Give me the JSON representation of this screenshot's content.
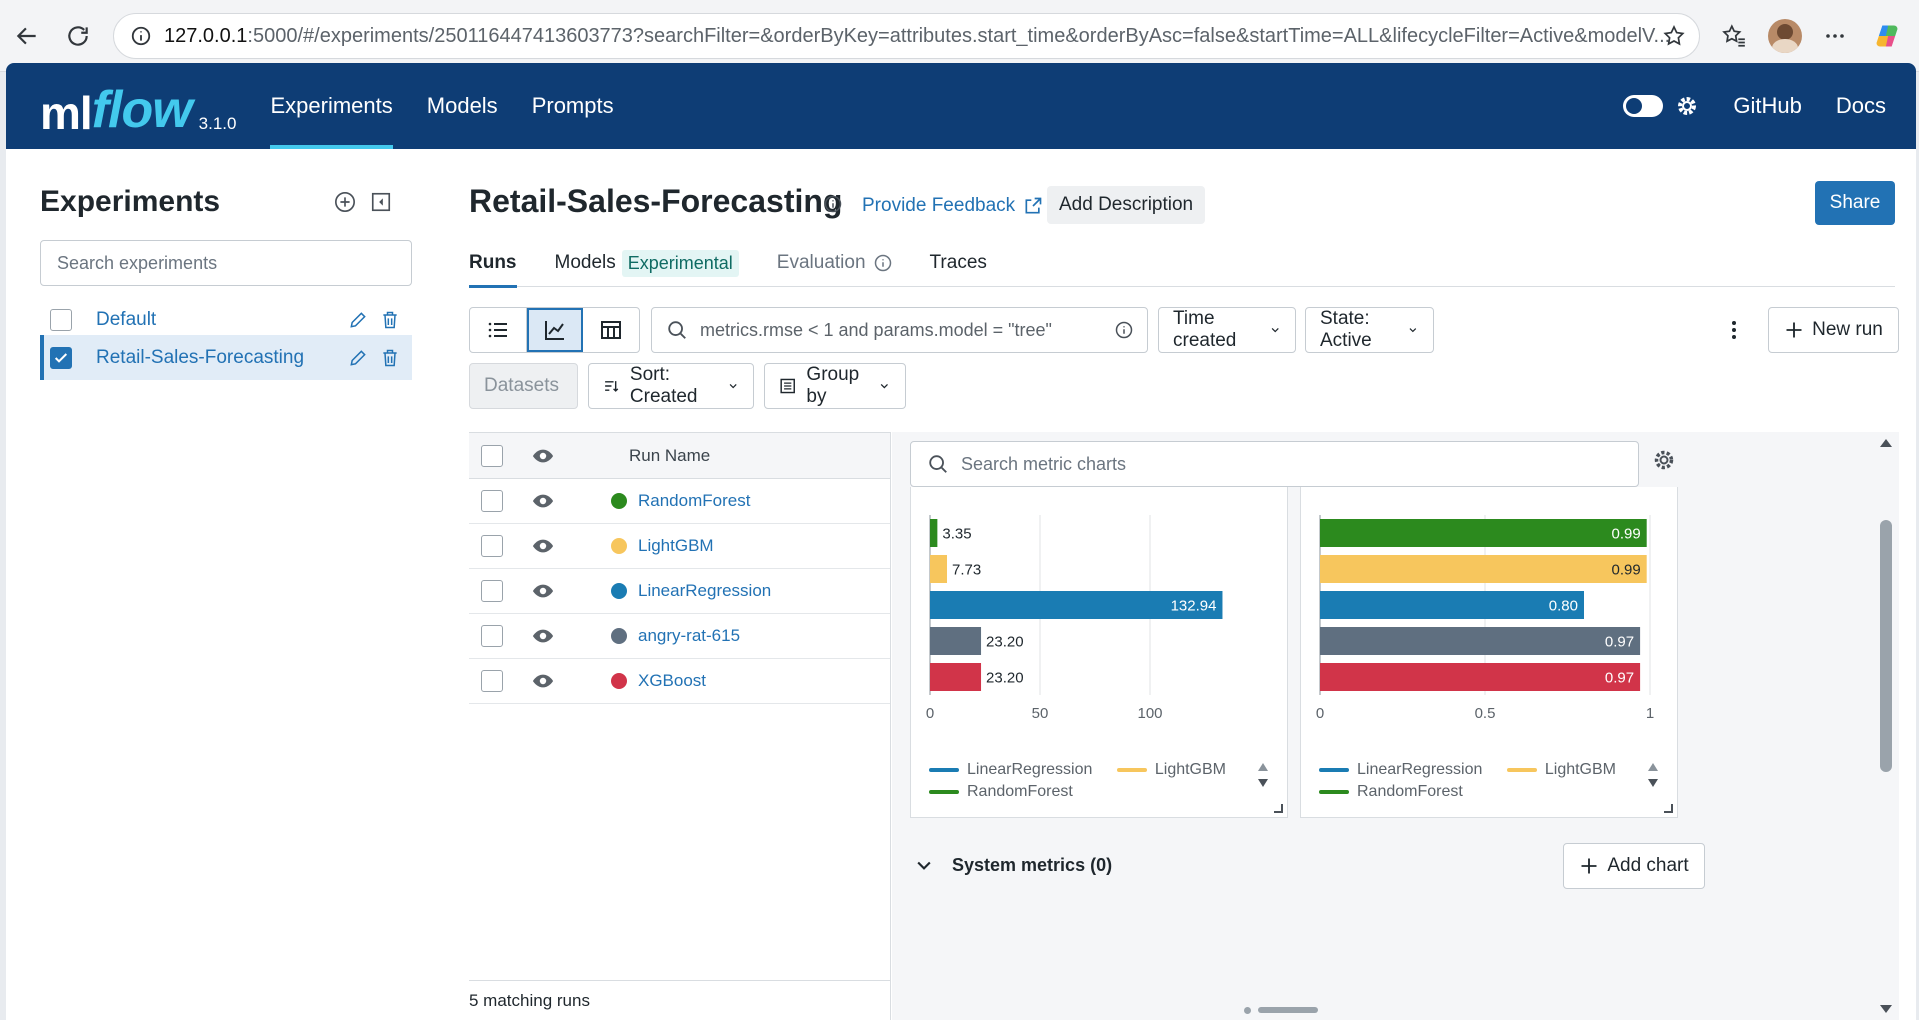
{
  "browser": {
    "url_host": "127.0.0.1",
    "url_rest": ":5000/#/experiments/250116447413603773?searchFilter=&orderByKey=attributes.start_time&orderByAsc=false&startTime=ALL&lifecycleFilter=Active&modelV..."
  },
  "nav": {
    "logo_ml": "ml",
    "logo_flow": "flow",
    "version": "3.1.0",
    "links": [
      "Experiments",
      "Models",
      "Prompts"
    ],
    "github": "GitHub",
    "docs": "Docs"
  },
  "sidebar": {
    "title": "Experiments",
    "search_placeholder": "Search experiments",
    "experiments": [
      {
        "name": "Default",
        "checked": false
      },
      {
        "name": "Retail-Sales-Forecasting",
        "checked": true
      }
    ]
  },
  "main": {
    "title": "Retail-Sales-Forecasting",
    "feedback": "Provide Feedback",
    "add_description": "Add Description",
    "share": "Share",
    "tabs": {
      "runs": "Runs",
      "models": "Models",
      "experimental_badge": "Experimental",
      "evaluation": "Evaluation",
      "traces": "Traces"
    },
    "filter_text": "metrics.rmse < 1 and params.model = \"tree\"",
    "time_created": "Time created",
    "state": "State: Active",
    "new_run": "New run",
    "datasets": "Datasets",
    "sort": "Sort: Created",
    "group_by": "Group by"
  },
  "table": {
    "column_run_name": "Run Name",
    "runs": [
      {
        "name": "RandomForest",
        "color": "#2c8a1e"
      },
      {
        "name": "LightGBM",
        "color": "#f7c65d"
      },
      {
        "name": "LinearRegression",
        "color": "#1a7cb3"
      },
      {
        "name": "angry-rat-615",
        "color": "#5f6f80"
      },
      {
        "name": "XGBoost",
        "color": "#d13449"
      }
    ],
    "footer": "5 matching runs"
  },
  "charts": {
    "search_placeholder": "Search metric charts",
    "system_metrics": "System metrics (0)",
    "add_chart": "Add chart",
    "legend": [
      {
        "name": "LinearRegression",
        "color": "#1a7cb3"
      },
      {
        "name": "LightGBM",
        "color": "#f7c65d"
      },
      {
        "name": "RandomForest",
        "color": "#2c8a1e"
      }
    ]
  },
  "chart_data": [
    {
      "type": "bar",
      "orientation": "horizontal",
      "categories": [
        "RandomForest",
        "LightGBM",
        "LinearRegression",
        "angry-rat-615",
        "XGBoost"
      ],
      "values": [
        3.35,
        7.73,
        132.94,
        23.2,
        23.2
      ],
      "value_labels": [
        "3.35",
        "7.73",
        "132.94",
        "23.20",
        "23.20"
      ],
      "colors": [
        "#2c8a1e",
        "#f7c65d",
        "#1a7cb3",
        "#5f6f80",
        "#d13449"
      ],
      "xlim": [
        0,
        150
      ],
      "xticks": [
        0,
        50,
        100
      ],
      "tick_labels": [
        "0",
        "50",
        "100"
      ],
      "grid": true
    },
    {
      "type": "bar",
      "orientation": "horizontal",
      "categories": [
        "RandomForest",
        "LightGBM",
        "LinearRegression",
        "angry-rat-615",
        "XGBoost"
      ],
      "values": [
        0.99,
        0.99,
        0.8,
        0.97,
        0.97
      ],
      "value_labels": [
        "0.99",
        "0.99",
        "0.80",
        "0.97",
        "0.97"
      ],
      "colors": [
        "#2c8a1e",
        "#f7c65d",
        "#1a7cb3",
        "#5f6f80",
        "#d13449"
      ],
      "xlim": [
        0,
        1
      ],
      "xticks": [
        0,
        0.5,
        1
      ],
      "tick_labels": [
        "0",
        "0.5",
        "1"
      ],
      "grid": true
    }
  ]
}
